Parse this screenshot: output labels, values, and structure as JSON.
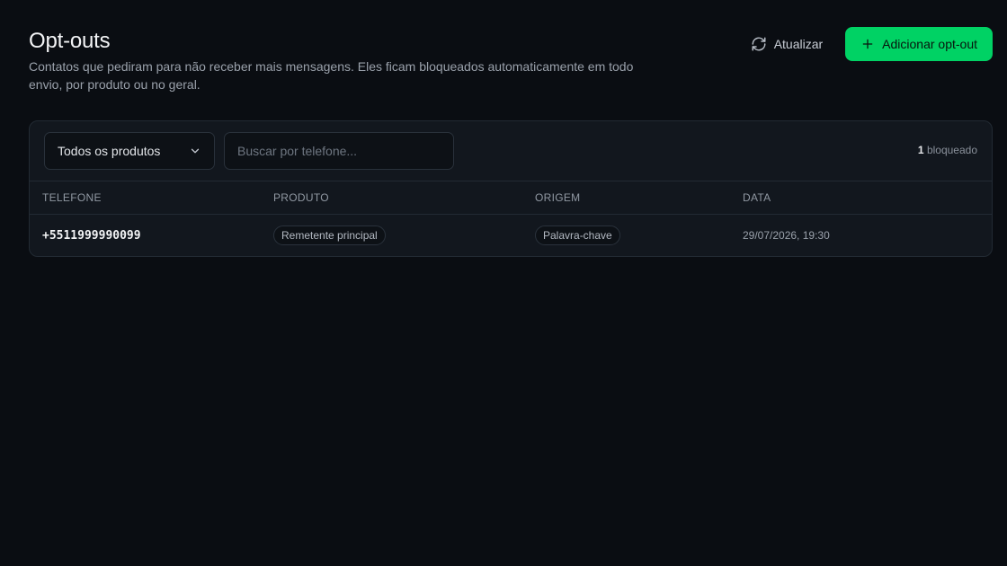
{
  "header": {
    "title": "Opt-outs",
    "subtitle": "Contatos que pediram para não receber mais mensagens. Eles ficam bloqueados automaticamente em todo envio, por produto ou no geral."
  },
  "actions": {
    "refresh_label": "Atualizar",
    "refresh_icon": "refresh-icon",
    "add_label": "Adicionar opt-out",
    "add_icon": "plus-icon"
  },
  "filters": {
    "product_select_value": "Todos os produtos",
    "search_placeholder": "Buscar por telefone...",
    "count_number": "1",
    "count_label": "bloqueado"
  },
  "table": {
    "columns": [
      "Telefone",
      "Produto",
      "Origem",
      "Data"
    ],
    "rows": [
      {
        "telefone": "+5511999990099",
        "produto": "Remetente principal",
        "origem": "Palavra-chave",
        "data": "29/07/2026, 19:30"
      }
    ]
  },
  "colors": {
    "background": "#0a0d12",
    "card": "#12171e",
    "accent": "#00d264"
  }
}
